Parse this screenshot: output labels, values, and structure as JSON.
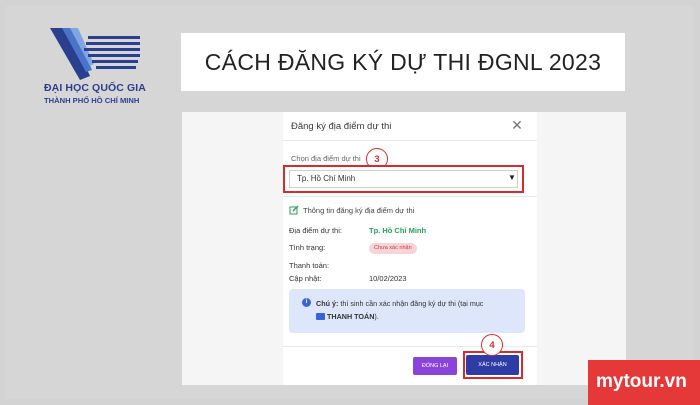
{
  "logo": {
    "line1": "ĐẠI HỌC QUỐC GIA",
    "line2": "THÀNH PHỐ HỒ CHÍ MINH"
  },
  "title": "CÁCH ĐĂNG KÝ DỰ THI ĐGNL 2023",
  "dialog": {
    "title": "Đăng ký địa điểm dự thi",
    "close_icon": "close-icon",
    "select_label": "Chọn địa điểm dự thi",
    "select_value": "Tp. Hồ Chí Minh",
    "caret": "▼",
    "info_heading": "Thông tin đăng ký địa điểm dự thi",
    "rows": [
      {
        "label": "Địa điểm dự thi:",
        "value": "Tp. Hồ Chí Minh"
      },
      {
        "label": "Tình trạng:",
        "value": "Chưa xác nhận"
      },
      {
        "label": "Thanh toán:",
        "value": ""
      },
      {
        "label": "Cập nhật:",
        "value": "10/02/2023"
      }
    ],
    "note": {
      "icon": "i",
      "bold": "Chú ý:",
      "text": " thí sinh cần xác nhận đăng ký dự thi (tại mục ",
      "link": "THANH TOÁN",
      "end": ")."
    },
    "btn_close": "ĐÓNG LẠI",
    "btn_confirm": "XÁC NHẬN"
  },
  "steps": {
    "step3": "3",
    "step4": "4"
  },
  "colors": {
    "accent_red": "#d62b2b",
    "brand_blue": "#2b3f8f",
    "confirm_blue": "#2f3ca6",
    "close_purple": "#8a44d9",
    "green": "#22a35a"
  },
  "watermark": "mytour.vn"
}
